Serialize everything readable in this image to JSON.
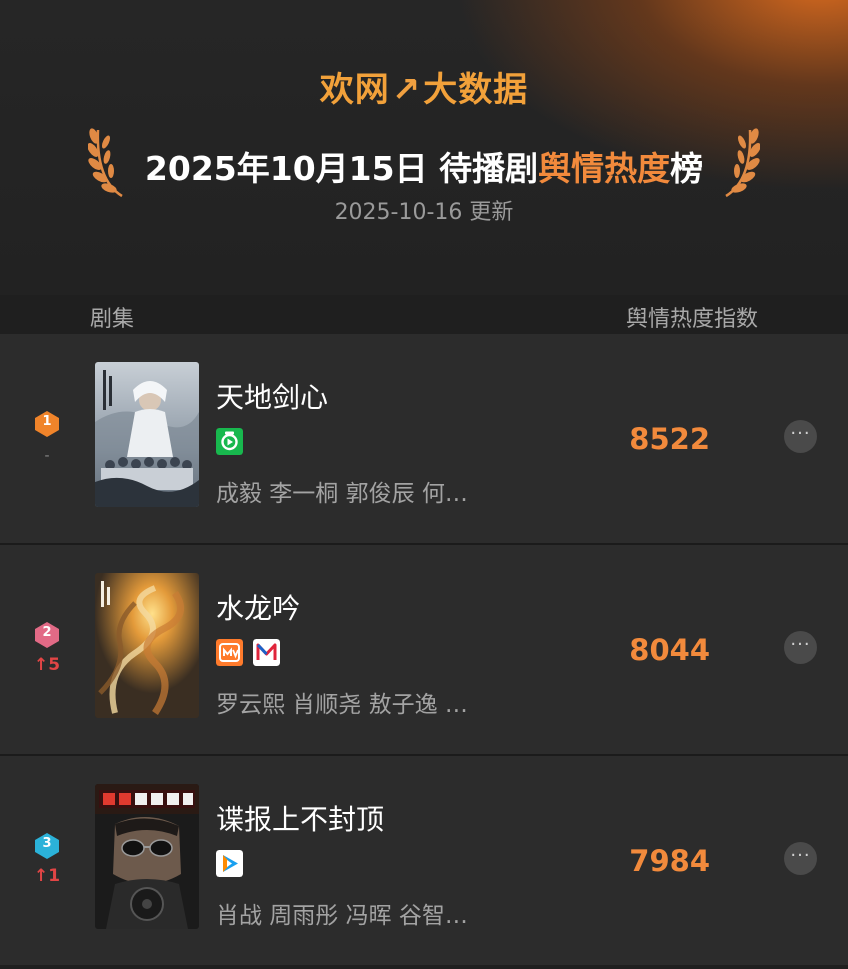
{
  "header": {
    "brand_left": "欢网",
    "brand_mark": "↗",
    "brand_right": "大数据",
    "title_prefix": "2025年10月15日 待播剧",
    "title_highlight": "舆情热度",
    "title_suffix": "榜",
    "updated": "2025-10-16 更新"
  },
  "columns": {
    "show": "剧集",
    "index": "舆情热度指数"
  },
  "rankings": [
    {
      "rank": "1",
      "rank_color": "#f0842a",
      "change": "-",
      "title": "天地剑心",
      "platforms": [
        "iqiyi-icon"
      ],
      "cast": "成毅 李一桐 郭俊辰 何…",
      "score": "8522"
    },
    {
      "rank": "2",
      "rank_color": "#e26a86",
      "change": "↑5",
      "title": "水龙吟",
      "platforms": [
        "mango-tv-icon",
        "migu-icon"
      ],
      "cast": "罗云熙 肖顺尧 敖子逸 …",
      "score": "8044"
    },
    {
      "rank": "3",
      "rank_color": "#2bb2d9",
      "change": "↑1",
      "title": "谍报上不封顶",
      "platforms": [
        "tencent-video-icon"
      ],
      "cast": "肖战 周雨彤 冯晖 谷智…",
      "score": "7984"
    }
  ],
  "more_label": "···",
  "colors": {
    "accent": "#f28a3c",
    "up_arrow": "#e24545",
    "background": "#1f1f1f",
    "row_background": "#2c2c2c"
  }
}
